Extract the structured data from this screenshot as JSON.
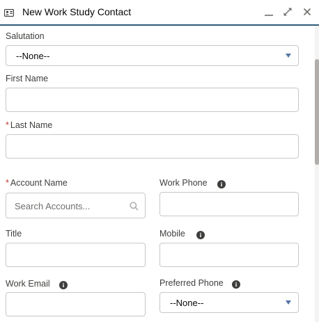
{
  "header": {
    "title": "New Work Study Contact"
  },
  "form": {
    "salutation": {
      "label": "Salutation",
      "value": "--None--"
    },
    "first_name": {
      "label": "First Name",
      "value": ""
    },
    "last_name": {
      "required_mark": "*",
      "label": "Last Name",
      "value": ""
    },
    "account_name": {
      "required_mark": "*",
      "label": "Account Name",
      "placeholder": "Search Accounts..."
    },
    "work_phone": {
      "label": "Work Phone",
      "value": ""
    },
    "title": {
      "label": "Title",
      "value": ""
    },
    "mobile": {
      "label": "Mobile",
      "value": ""
    },
    "work_email": {
      "label": "Work Email",
      "value": ""
    },
    "preferred_phone": {
      "label": "Preferred Phone",
      "value": "--None--"
    }
  },
  "info_glyph": "i"
}
